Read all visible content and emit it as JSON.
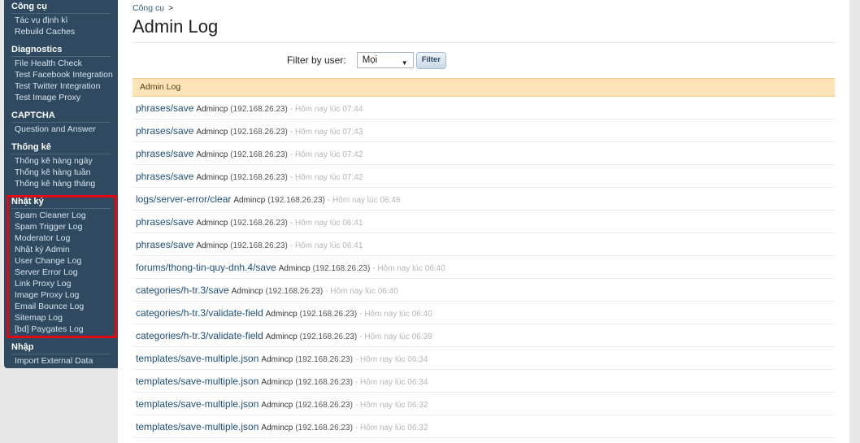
{
  "sidebar": {
    "sections": [
      {
        "title": "Công cụ",
        "items": [
          "Tác vụ định kì",
          "Rebuild Caches"
        ]
      },
      {
        "title": "Diagnostics",
        "items": [
          "File Health Check",
          "Test Facebook Integration",
          "Test Twitter Integration",
          "Test Image Proxy"
        ]
      },
      {
        "title": "CAPTCHA",
        "items": [
          "Question and Answer"
        ]
      },
      {
        "title": "Thống kê",
        "items": [
          "Thống kê hàng ngày",
          "Thống kê hàng tuần",
          "Thống kê hàng tháng"
        ]
      },
      {
        "title": "Nhật ký",
        "items": [
          "Spam Cleaner Log",
          "Spam Trigger Log",
          "Moderator Log",
          "Nhật ký Admin",
          "User Change Log",
          "Server Error Log",
          "Link Proxy Log",
          "Image Proxy Log",
          "Email Bounce Log",
          "Sitemap Log",
          "[bd] Paygates Log"
        ]
      },
      {
        "title": "Nhập",
        "items": [
          "Import External Data"
        ]
      }
    ],
    "highlight_color": "#e30613"
  },
  "breadcrumb": {
    "item": "Công cụ",
    "separator": ">"
  },
  "page_title": "Admin Log",
  "filter": {
    "label": "Filter by user:",
    "selected": "Mọi",
    "button": "Filter"
  },
  "log_header": "Admin Log",
  "log_entries": [
    {
      "action": "phrases/save",
      "user": "Admincp",
      "ip": "(192.168.26.23)",
      "time": "- Hôm nay lúc 07:44"
    },
    {
      "action": "phrases/save",
      "user": "Admincp",
      "ip": "(192.168.26.23)",
      "time": "- Hôm nay lúc 07:43"
    },
    {
      "action": "phrases/save",
      "user": "Admincp",
      "ip": "(192.168.26.23)",
      "time": "- Hôm nay lúc 07:42"
    },
    {
      "action": "phrases/save",
      "user": "Admincp",
      "ip": "(192.168.26.23)",
      "time": "- Hôm nay lúc 07:42"
    },
    {
      "action": "logs/server-error/clear",
      "user": "Admincp",
      "ip": "(192.168.26.23)",
      "time": "- Hôm nay lúc 06:48"
    },
    {
      "action": "phrases/save",
      "user": "Admincp",
      "ip": "(192.168.26.23)",
      "time": "- Hôm nay lúc 06:41"
    },
    {
      "action": "phrases/save",
      "user": "Admincp",
      "ip": "(192.168.26.23)",
      "time": "- Hôm nay lúc 06:41"
    },
    {
      "action": "forums/thong-tin-quy-dnh.4/save",
      "user": "Admincp",
      "ip": "(192.168.26.23)",
      "time": "- Hôm nay lúc 06:40"
    },
    {
      "action": "categories/h-tr.3/save",
      "user": "Admincp",
      "ip": "(192.168.26.23)",
      "time": "- Hôm nay lúc 06:40"
    },
    {
      "action": "categories/h-tr.3/validate-field",
      "user": "Admincp",
      "ip": "(192.168.26.23)",
      "time": "- Hôm nay lúc 06:40"
    },
    {
      "action": "categories/h-tr.3/validate-field",
      "user": "Admincp",
      "ip": "(192.168.26.23)",
      "time": "- Hôm nay lúc 06:39"
    },
    {
      "action": "templates/save-multiple.json",
      "user": "Admincp",
      "ip": "(192.168.26.23)",
      "time": "- Hôm nay lúc 06:34"
    },
    {
      "action": "templates/save-multiple.json",
      "user": "Admincp",
      "ip": "(192.168.26.23)",
      "time": "- Hôm nay lúc 06:34"
    },
    {
      "action": "templates/save-multiple.json",
      "user": "Admincp",
      "ip": "(192.168.26.23)",
      "time": "- Hôm nay lúc 06:32"
    },
    {
      "action": "templates/save-multiple.json",
      "user": "Admincp",
      "ip": "(192.168.26.23)",
      "time": "- Hôm nay lúc 06:32"
    }
  ]
}
